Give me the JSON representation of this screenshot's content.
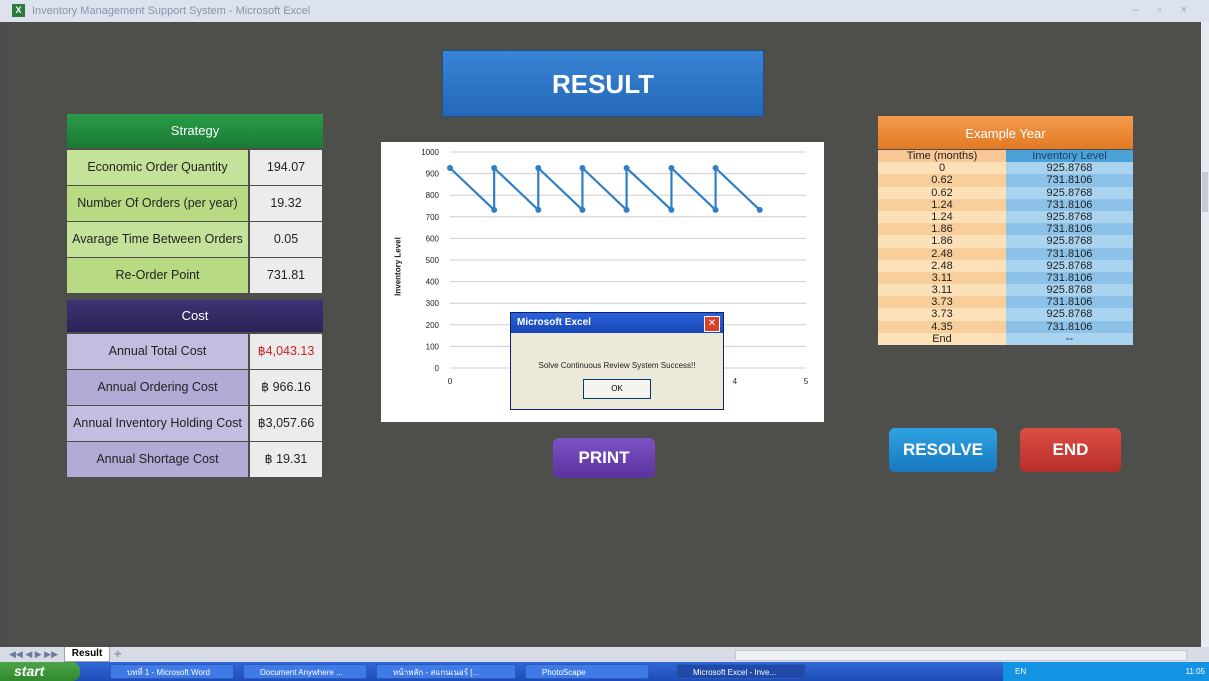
{
  "window": {
    "title": "Inventory Management Support System - Microsoft Excel"
  },
  "banner": {
    "title": "RESULT"
  },
  "strategy": {
    "header": "Strategy",
    "rows": [
      {
        "label": "Economic Order Quantity",
        "value": "194.07"
      },
      {
        "label": "Number Of Orders (per year)",
        "value": "19.32"
      },
      {
        "label": "Avarage Time Between Orders",
        "value": "0.05"
      },
      {
        "label": "Re-Order Point",
        "value": "731.81"
      }
    ]
  },
  "cost": {
    "header": "Cost",
    "rows": [
      {
        "label": "Annual Total Cost",
        "value": "฿4,043.13"
      },
      {
        "label": "Annual Ordering Cost",
        "value": "฿ 966.16"
      },
      {
        "label": "Annual Inventory Holding Cost",
        "value": "฿3,057.66"
      },
      {
        "label": "Annual Shortage Cost",
        "value": "฿ 19.31"
      }
    ]
  },
  "chart_data": {
    "type": "line",
    "ylabel": "Inventory Level",
    "xlim": [
      0,
      5
    ],
    "ylim": [
      0,
      1000
    ],
    "xticks": [
      "0",
      "1",
      "2",
      "3",
      "4",
      "5"
    ],
    "yticks": [
      "0",
      "100",
      "200",
      "300",
      "400",
      "500",
      "600",
      "700",
      "800",
      "900",
      "1000"
    ],
    "series": [
      {
        "x": [
          0,
          0.62,
          0.62,
          1.24,
          1.24,
          1.86,
          1.86,
          2.48,
          2.48,
          3.11,
          3.11,
          3.73,
          3.73,
          4.35
        ],
        "values": [
          925.8768,
          731.8106,
          925.8768,
          731.8106,
          925.8768,
          731.8106,
          925.8768,
          731.8106,
          925.8768,
          731.8106,
          925.8768,
          731.8106,
          925.8768,
          731.8106
        ]
      }
    ],
    "line_color": "#2f7fc4"
  },
  "dialog": {
    "title": "Microsoft Excel",
    "message": "Solve Continuous Review System Success!!",
    "ok_label": "OK"
  },
  "buttons": {
    "print": "PRINT",
    "resolve": "RESOLVE",
    "end": "END"
  },
  "example": {
    "header": "Example Year",
    "col1": "Time (months)",
    "col2": "Inventory Level",
    "rows": [
      [
        "0",
        "925.8768"
      ],
      [
        "0.62",
        "731.8106"
      ],
      [
        "0.62",
        "925.8768"
      ],
      [
        "1.24",
        "731.8106"
      ],
      [
        "1.24",
        "925.8768"
      ],
      [
        "1.86",
        "731.8106"
      ],
      [
        "1.86",
        "925.8768"
      ],
      [
        "2.48",
        "731.8106"
      ],
      [
        "2.48",
        "925.8768"
      ],
      [
        "3.11",
        "731.8106"
      ],
      [
        "3.11",
        "925.8768"
      ],
      [
        "3.73",
        "731.8106"
      ],
      [
        "3.73",
        "925.8768"
      ],
      [
        "4.35",
        "731.8106"
      ],
      [
        "End",
        "--"
      ]
    ]
  },
  "sheet_tab": {
    "label": "Result"
  },
  "taskbar": {
    "start": "start",
    "items": [
      "บทที่ 1 - Microsoft Word",
      "Document Anywhere ...",
      "หน้าหลัก - สแกนเนอร์ [...",
      "PhotoScape",
      "Microsoft Excel - Inve..."
    ],
    "lang": "EN",
    "clock": "11:05"
  },
  "colors": {
    "strategy_header": "#1f8a3c",
    "strategy_label_bg": "#c5e29a",
    "cost_header": "#3a2f6e",
    "cost_label_bg": "#c4bde0",
    "negative_value": "#cc2222",
    "print_btn": "#6a3fb0",
    "resolve_btn": "#1f8fd0",
    "end_btn": "#cc3a32"
  }
}
